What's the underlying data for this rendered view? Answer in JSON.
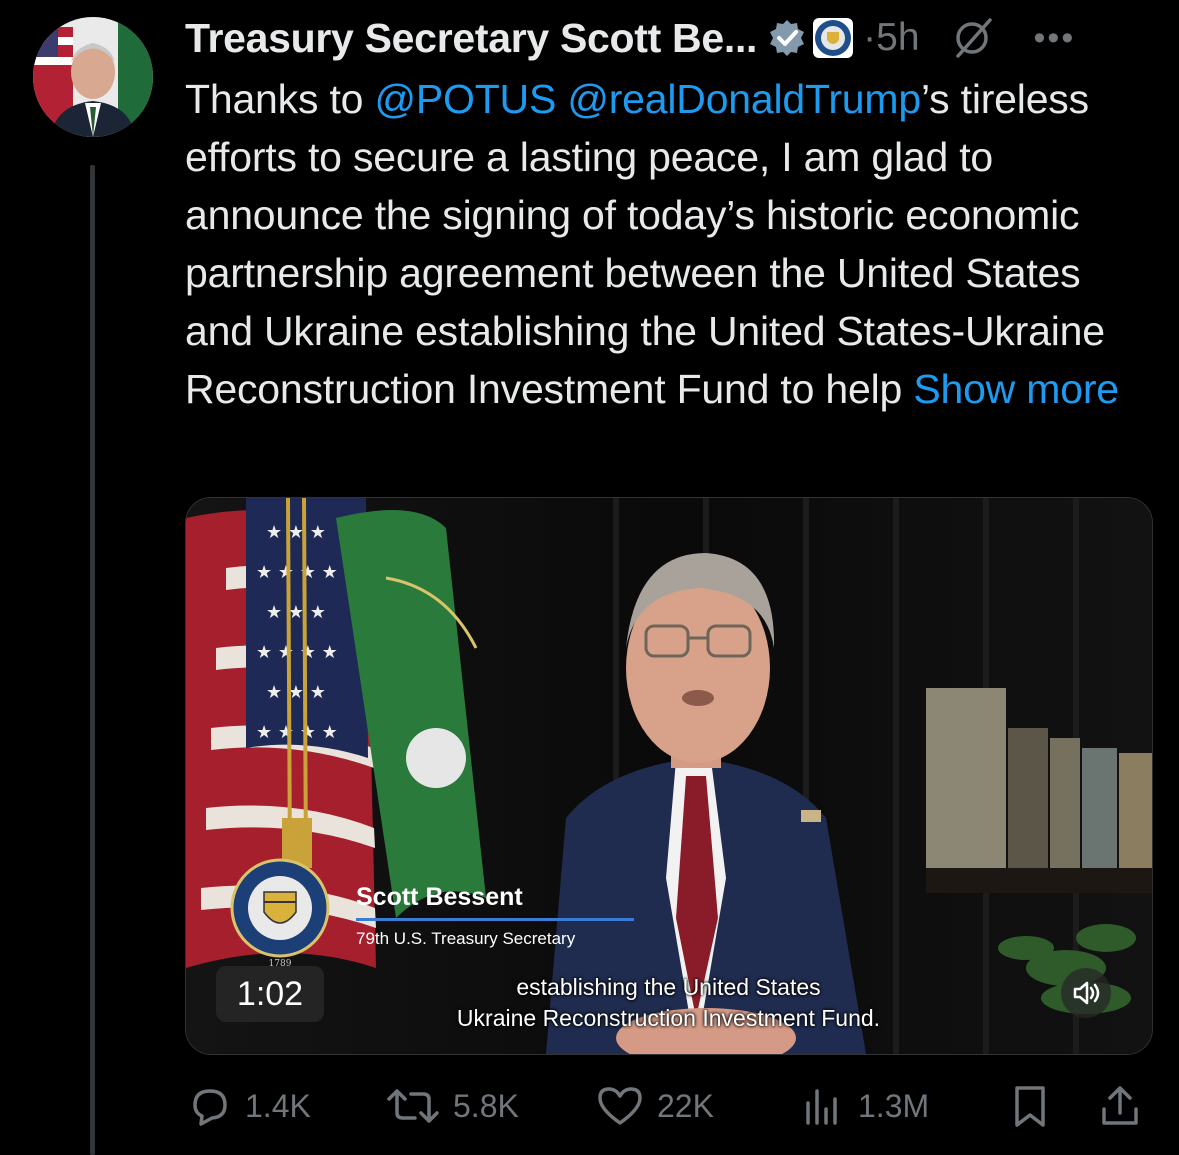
{
  "author": {
    "name": "Treasury Secretary Scott Be...",
    "verified_icon": "verified-badge-icon",
    "affiliation_icon": "treasury-seal-icon",
    "time": "5h",
    "separator": "·"
  },
  "tweet": {
    "text_parts": {
      "p1": "Thanks to ",
      "mention1": "@POTUS",
      "space": " ",
      "mention2": "@realDonaldTrump",
      "p2": "’s tireless efforts to secure a lasting peace, I am glad to announce the signing of today’s historic economic partnership agreement between the United States and Ukraine establishing the United States-Ukraine Reconstruction Investment Fund to help ",
      "show_more": "Show more"
    }
  },
  "video": {
    "lower_third_name": "Scott Bessent",
    "lower_third_title": "79th U.S. Treasury Secretary",
    "duration": "1:02",
    "caption_line1": "establishing the United States",
    "caption_line2": "Ukraine Reconstruction Investment Fund.",
    "seal_year": "1789"
  },
  "actions": {
    "replies": "1.4K",
    "reposts": "5.8K",
    "likes": "22K",
    "views": "1.3M"
  },
  "colors": {
    "background": "#000000",
    "text": "#e7e9ea",
    "muted": "#71767b",
    "link": "#1d9bf0",
    "verified": "#829aab"
  }
}
